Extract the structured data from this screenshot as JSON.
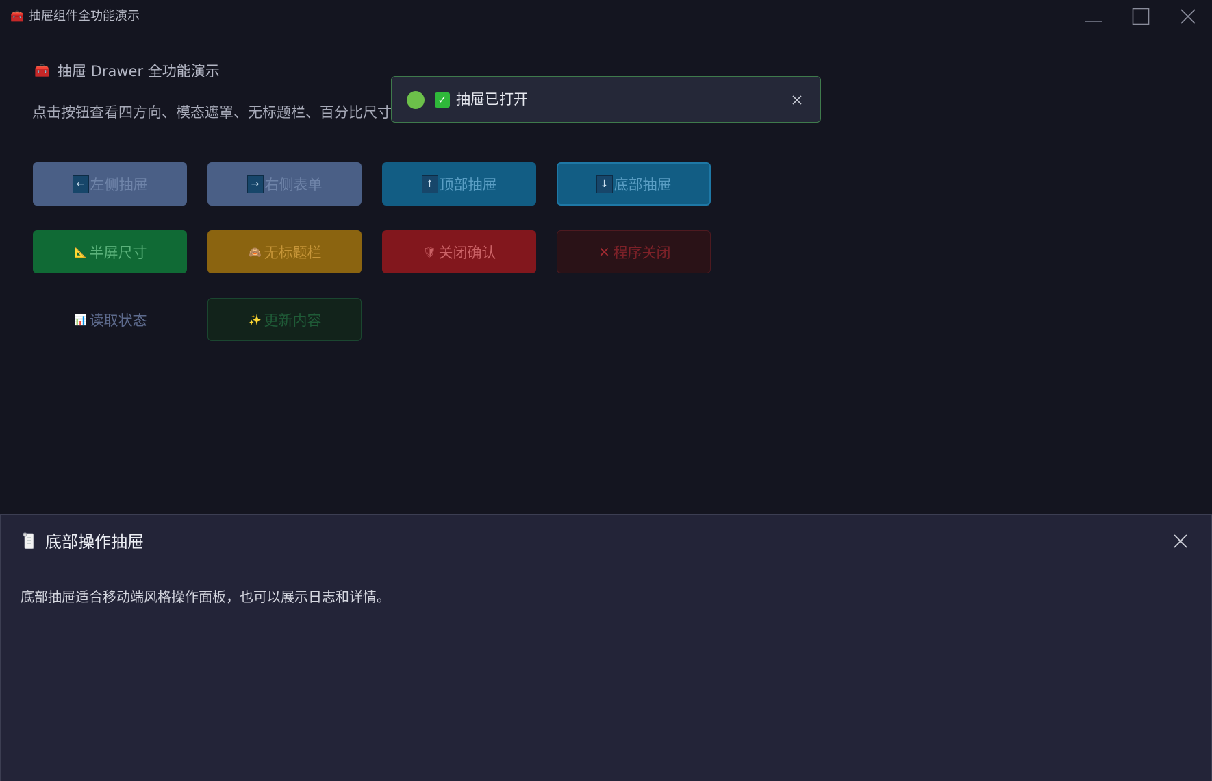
{
  "window": {
    "title": "抽屉组件全功能演示",
    "icon": "toolbox-icon",
    "controls": [
      "minimize-icon",
      "maximize-icon",
      "close-icon"
    ]
  },
  "main": {
    "heading": "抽屉 Drawer 全功能演示",
    "heading_icon": "🧰",
    "description": "点击按钮查看四方向、模态遮罩、无标题栏、百分比尺寸",
    "buttons": [
      {
        "icon": "←",
        "label": "左侧抽屉"
      },
      {
        "icon": "→",
        "label": "右侧表单"
      },
      {
        "icon": "↑",
        "label": "顶部抽屉"
      },
      {
        "icon": "↓",
        "label": "底部抽屉"
      },
      {
        "icon": "📐",
        "label": "半屏尺寸"
      },
      {
        "icon": "🙈",
        "label": "无标题栏"
      },
      {
        "icon": "🛡",
        "label": "关闭确认"
      },
      {
        "icon": "✕",
        "label": "程序关闭"
      },
      {
        "icon": "📊",
        "label": "读取状态"
      },
      {
        "icon": "✨",
        "label": "更新内容"
      }
    ]
  },
  "toast": {
    "check": "✓",
    "message": "抽屉已打开"
  },
  "drawer": {
    "title": "底部操作抽屉",
    "body": "底部抽屉适合移动端风格操作面板，也可以展示日志和详情。"
  },
  "colors": {
    "background": "#141520",
    "drawer_bg": "#232438",
    "toast_border": "#3f7a4c",
    "success": "#6cc04a"
  }
}
